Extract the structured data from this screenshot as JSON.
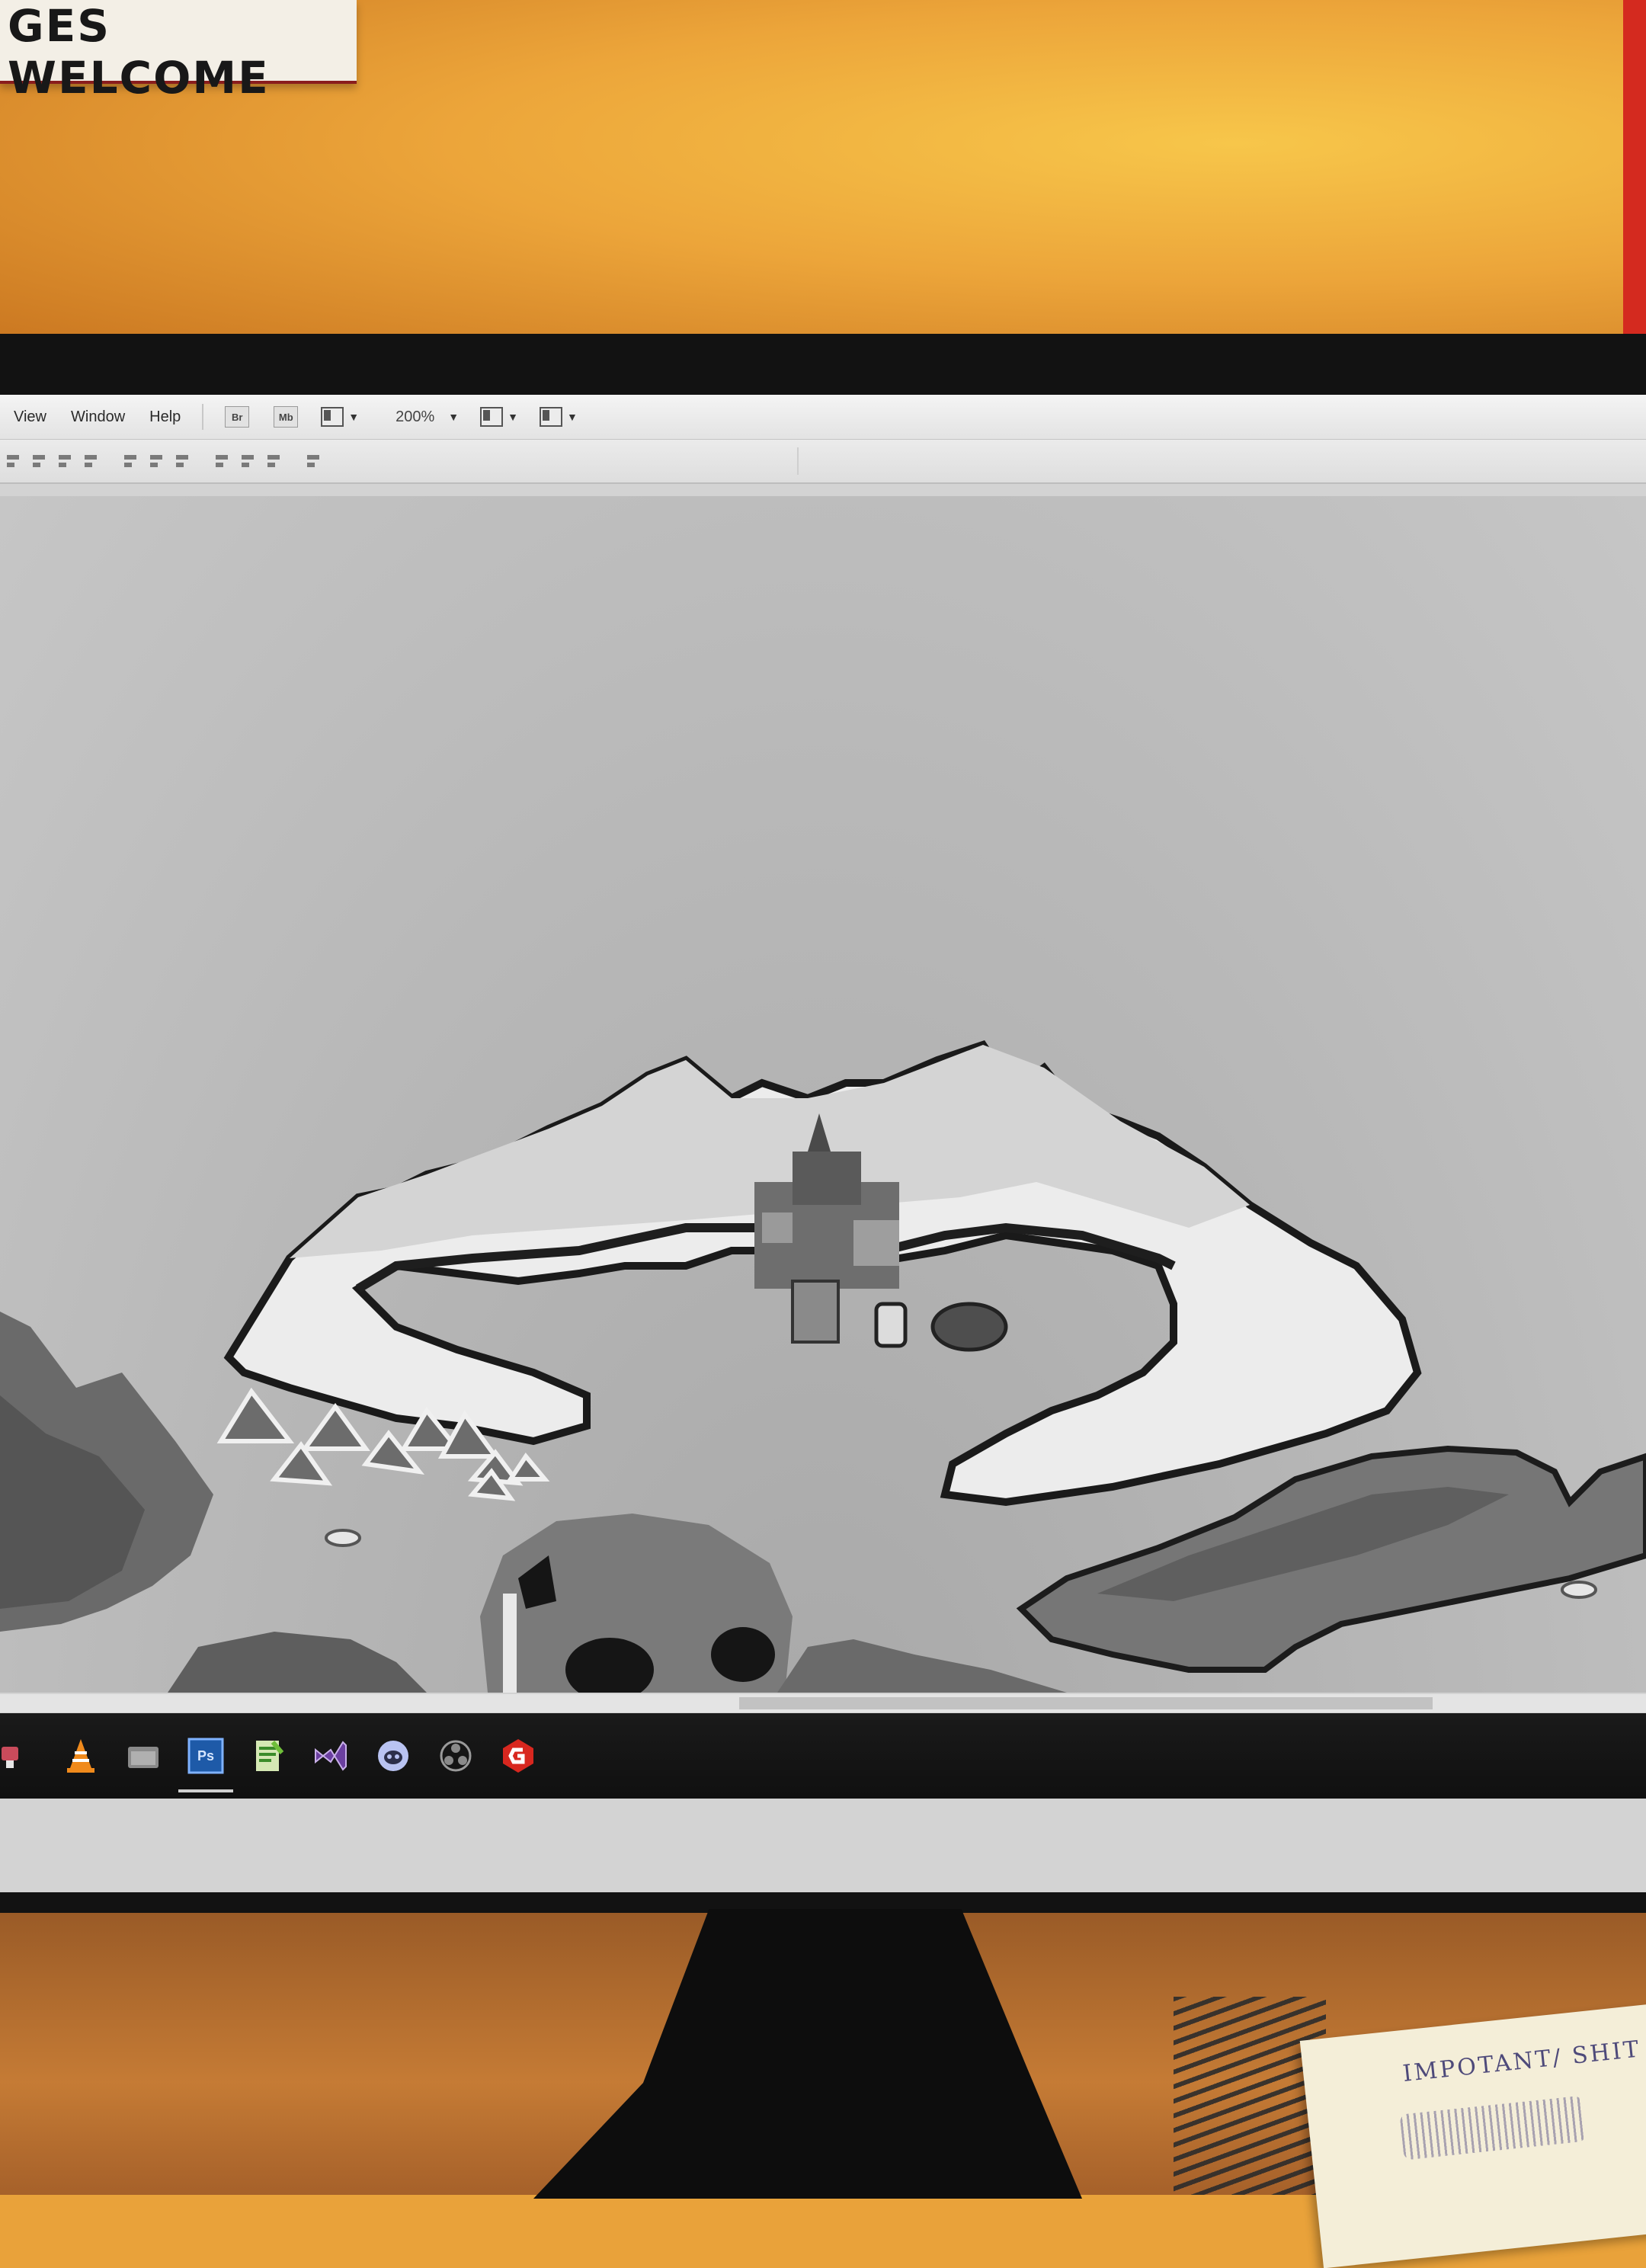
{
  "wall": {
    "sign_text": "GES WELCOME"
  },
  "menubar": {
    "items": [
      "View",
      "Window",
      "Help"
    ],
    "bridge_label": "Br",
    "minibridge_label": "Mb",
    "zoom": "200%"
  },
  "taskbar": {
    "icons": [
      "app-red-icon",
      "vlc-icon",
      "explorer-icon",
      "photoshop-icon",
      "notepadpp-icon",
      "visual-studio-icon",
      "discord-icon",
      "obs-icon",
      "gamemaker-icon"
    ],
    "photoshop_label": "Ps"
  },
  "notepad": {
    "text": "IMPOTANT/ SHIT"
  },
  "colors": {
    "wall": "#eca53a",
    "screen_bg": "#bdbdbd",
    "taskbar": "#121212",
    "vlc": "#f08a1c",
    "photoshop": "#1e5aa8",
    "visual_studio": "#6b3fa0",
    "gamemaker": "#d8271f"
  }
}
